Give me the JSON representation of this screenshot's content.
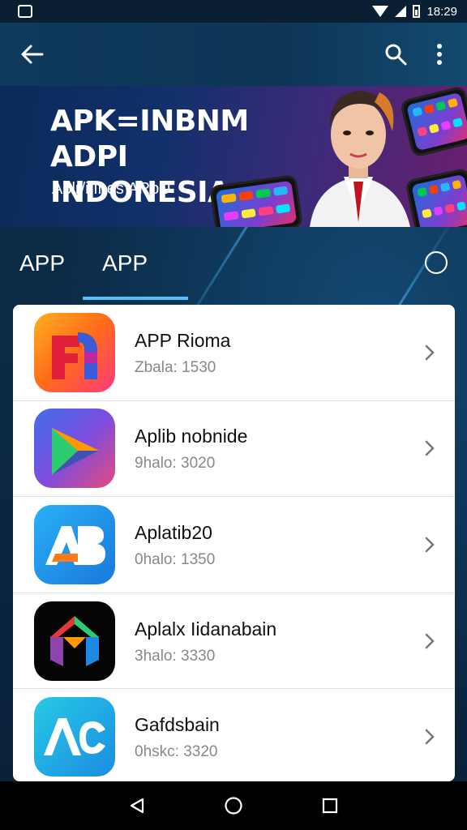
{
  "status_bar": {
    "time": "18:29"
  },
  "app_bar": {
    "back_icon": "arrow-left-icon",
    "search_icon": "search-icon",
    "more_icon": "more-vertical-icon"
  },
  "banner": {
    "title": "APK=INBNM\nADPI INDONESIA",
    "subtitle": "Aplr/i Ihes ARpU"
  },
  "tabs": [
    {
      "label": "APP",
      "active": false
    },
    {
      "label": "APP",
      "active": true
    }
  ],
  "apps": [
    {
      "name": "APP Rioma",
      "meta": "Zbala: 1530",
      "icon": "app-rioma-icon",
      "colors": [
        "#ff7a1a",
        "#ff2f6d"
      ]
    },
    {
      "name": "Aplib nobnide",
      "meta": "9halo: 3020",
      "icon": "play-triangle-icon",
      "colors": [
        "#6a4df0",
        "#e0397e"
      ]
    },
    {
      "name": "Aplatib20",
      "meta": "0halo: 1350",
      "icon": "ab-logo-icon",
      "colors": [
        "#1fa4f0",
        "#1b70d6"
      ]
    },
    {
      "name": "Aplalx Iidanabain",
      "meta": "3halo: 3330",
      "icon": "house-logo-icon",
      "colors": [
        "#000000",
        "#111111"
      ]
    },
    {
      "name": "Gafdsbain",
      "meta": "0hskc: 3320",
      "icon": "ac-logo-icon",
      "colors": [
        "#1fc3e0",
        "#1d8fe0"
      ]
    }
  ],
  "colors": {
    "accent": "#4fc3f7",
    "background": "#0b2440",
    "list_bg": "#ffffff"
  }
}
